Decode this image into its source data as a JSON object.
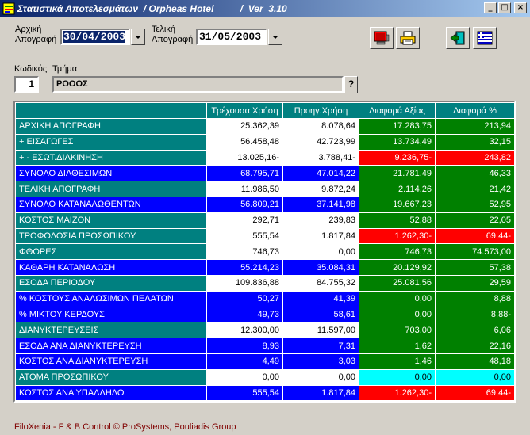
{
  "window": {
    "title": "Στατιστικά Αποτελεσμάτων  / Orpheas Hotel          /  Ver  3.10",
    "controls": {
      "minimize": "_",
      "maximize": "□",
      "close": "×"
    }
  },
  "filters": {
    "start_label_1": "Αρχική",
    "start_label_2": "Απογραφή",
    "start_date": "30/04/2003",
    "end_label_1": "Τελική",
    "end_label_2": "Απογραφή",
    "end_date": "31/05/2003"
  },
  "toolbar": {
    "icons": [
      "screen-preview-icon",
      "printer-icon",
      "exit-door-icon",
      "language-flag-icon"
    ]
  },
  "department": {
    "code_label": "Κωδικός",
    "code_value": "1",
    "dept_label": "Τμήμα",
    "dept_value": "ΡΟΟΟΣ",
    "lookup_label": "?"
  },
  "table": {
    "headers": [
      "",
      "Τρέχουσα Χρήση",
      "Προηγ.Χρήση",
      "Διαφορά Αξίας",
      "Διαφορά %"
    ],
    "rows": [
      {
        "label": "ΑΡΧΙΚΗ ΑΠΟΓΡΑΦΗ",
        "current": "25.362,39",
        "previous": "8.078,64",
        "diff": "17.283,75",
        "pct": "213,94",
        "style": "teal",
        "diff_color": "green",
        "pct_color": "green"
      },
      {
        "label": "+ ΕΙΣΑΓΩΓΕΣ",
        "current": "56.458,48",
        "previous": "42.723,99",
        "diff": "13.734,49",
        "pct": "32,15",
        "style": "teal",
        "diff_color": "green",
        "pct_color": "green"
      },
      {
        "label": "+ - ΕΣΩΤ.ΔΙΑΚΙΝΗΣΗ",
        "current": "13.025,16-",
        "previous": "3.788,41-",
        "diff": "9.236,75-",
        "pct": "243,82",
        "style": "teal",
        "diff_color": "red",
        "pct_color": "red"
      },
      {
        "label": "ΣΥΝΟΛΟ ΔΙΑΘΕΣΙΜΩΝ",
        "current": "68.795,71",
        "previous": "47.014,22",
        "diff": "21.781,49",
        "pct": "46,33",
        "style": "blue",
        "diff_color": "green",
        "pct_color": "green"
      },
      {
        "label": "ΤΕΛΙΚΗ ΑΠΟΓΡΑΦΗ",
        "current": "11.986,50",
        "previous": "9.872,24",
        "diff": "2.114,26",
        "pct": "21,42",
        "style": "teal",
        "diff_color": "green",
        "pct_color": "green"
      },
      {
        "label": "ΣΥΝΟΛΟ ΚΑΤΑΝΑΛΩΘΕΝΤΩΝ",
        "current": "56.809,21",
        "previous": "37.141,98",
        "diff": "19.667,23",
        "pct": "52,95",
        "style": "blue",
        "diff_color": "green",
        "pct_color": "green"
      },
      {
        "label": "ΚΟΣΤΟΣ ΜΑΙΖΟΝ",
        "current": "292,71",
        "previous": "239,83",
        "diff": "52,88",
        "pct": "22,05",
        "style": "teal",
        "diff_color": "green",
        "pct_color": "green"
      },
      {
        "label": "ΤΡΟΦΟΔΟΣΙΑ ΠΡΟΣΩΠΙΚΟΥ",
        "current": "555,54",
        "previous": "1.817,84",
        "diff": "1.262,30-",
        "pct": "69,44-",
        "style": "teal",
        "diff_color": "red",
        "pct_color": "red"
      },
      {
        "label": "ΦΘΟΡΕΣ",
        "current": "746,73",
        "previous": "0,00",
        "diff": "746,73",
        "pct": "74.573,00",
        "style": "teal",
        "diff_color": "green",
        "pct_color": "green"
      },
      {
        "label": "ΚΑΘΑΡΗ ΚΑΤΑΝΑΛΩΣΗ",
        "current": "55.214,23",
        "previous": "35.084,31",
        "diff": "20.129,92",
        "pct": "57,38",
        "style": "blue",
        "diff_color": "green",
        "pct_color": "green"
      },
      {
        "label": "ΕΣΟΔΑ ΠΕΡΙΟΔΟΥ",
        "current": "109.836,88",
        "previous": "84.755,32",
        "diff": "25.081,56",
        "pct": "29,59",
        "style": "teal",
        "diff_color": "green",
        "pct_color": "green"
      },
      {
        "label": "% ΚΟΣΤΟΥΣ ΑΝΑΛΩΣΙΜΩΝ ΠΕΛΑΤΩΝ",
        "current": "50,27",
        "previous": "41,39",
        "diff": "0,00",
        "pct": "8,88",
        "style": "blue",
        "diff_color": "green",
        "pct_color": "green"
      },
      {
        "label": "% ΜΙΚΤΟΥ ΚΕΡΔΟΥΣ",
        "current": "49,73",
        "previous": "58,61",
        "diff": "0,00",
        "pct": "8,88-",
        "style": "blue",
        "diff_color": "green",
        "pct_color": "green"
      },
      {
        "label": "ΔΙΑΝΥΚΤΕΡΕΥΣΕΙΣ",
        "current": "12.300,00",
        "previous": "11.597,00",
        "diff": "703,00",
        "pct": "6,06",
        "style": "teal",
        "diff_color": "green",
        "pct_color": "green"
      },
      {
        "label": "ΕΣΟΔΑ ΑΝΑ ΔΙΑΝΥΚΤΕΡΕΥΣΗ",
        "current": "8,93",
        "previous": "7,31",
        "diff": "1,62",
        "pct": "22,16",
        "style": "blue",
        "diff_color": "green",
        "pct_color": "green"
      },
      {
        "label": "ΚΟΣΤΟΣ ΑΝΑ ΔΙΑΝΥΚΤΕΡΕΥΣΗ",
        "current": "4,49",
        "previous": "3,03",
        "diff": "1,46",
        "pct": "48,18",
        "style": "blue",
        "diff_color": "green",
        "pct_color": "green"
      },
      {
        "label": "ΑΤΟΜΑ ΠΡΟΣΩΠΙΚΟΥ",
        "current": "0,00",
        "previous": "0,00",
        "diff": "0,00",
        "pct": "0,00",
        "style": "teal",
        "diff_color": "cyan",
        "pct_color": "cyan"
      },
      {
        "label": "ΚΟΣΤΟΣ ΑΝΑ ΥΠΑΛΛΗΛΟ",
        "current": "555,54",
        "previous": "1.817,84",
        "diff": "1.262,30-",
        "pct": "69,44-",
        "style": "blue",
        "diff_color": "red",
        "pct_color": "red"
      }
    ]
  },
  "footer": {
    "text": "FiloXenia - F & B Control  © ProSystems,  Pouliadis Group"
  },
  "colors": {
    "teal": "#008080",
    "blue": "#0000ff",
    "green": "#008000",
    "red": "#ff0000",
    "cyan": "#00ffff"
  }
}
